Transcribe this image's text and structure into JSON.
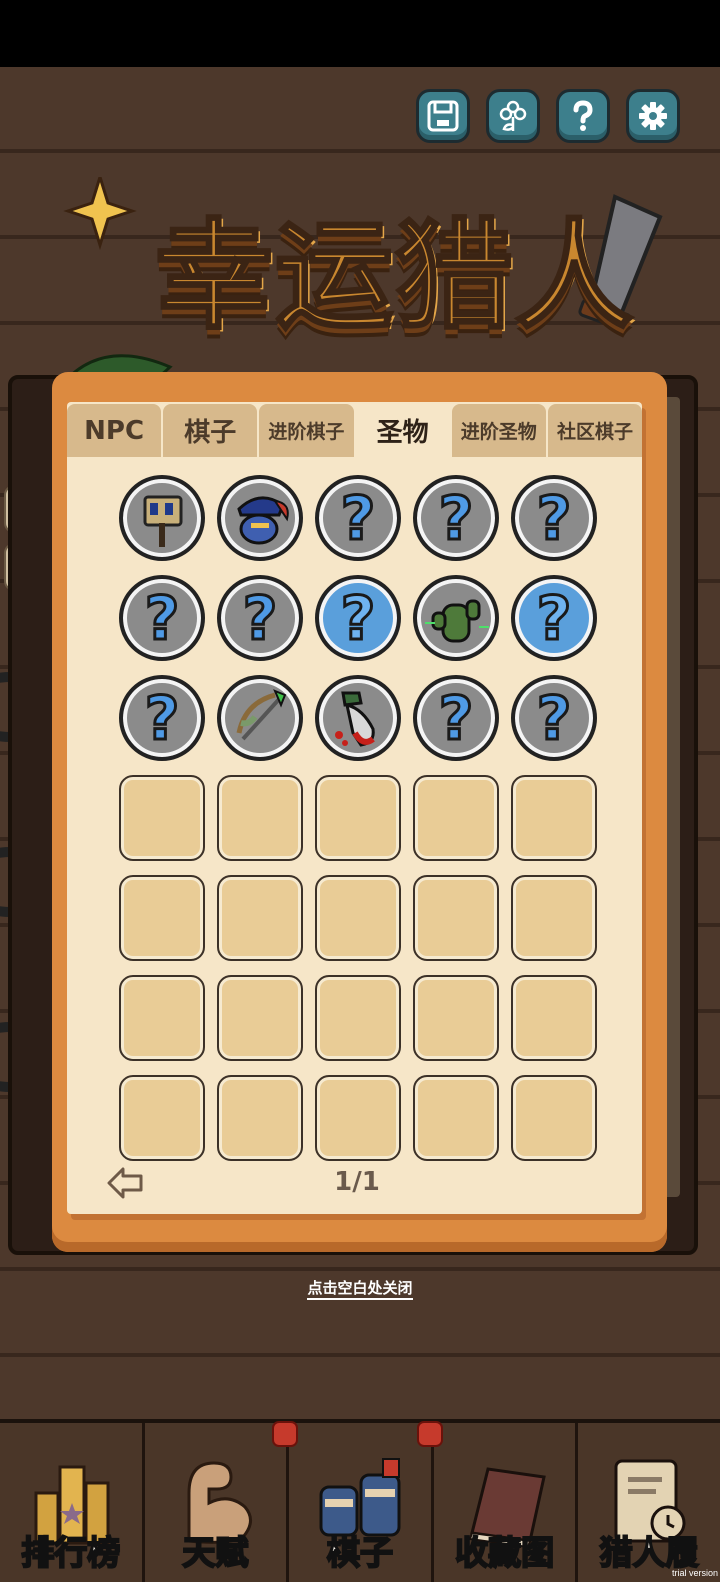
{
  "header": {
    "buttons": [
      {
        "name": "save-button",
        "icon": "save-icon"
      },
      {
        "name": "community-button",
        "icon": "flower-icon"
      },
      {
        "name": "help-button",
        "icon": "question-icon"
      },
      {
        "name": "settings-button",
        "icon": "gear-icon"
      }
    ]
  },
  "title": {
    "text": "幸运猎人"
  },
  "panel": {
    "tabs": [
      {
        "label": "NPC",
        "active": false
      },
      {
        "label": "棋子",
        "active": false
      },
      {
        "label": "进阶棋子",
        "active": false
      },
      {
        "label": "圣物",
        "active": true
      },
      {
        "label": "进阶圣物",
        "active": false
      },
      {
        "label": "社区棋子",
        "active": false
      }
    ],
    "grid_rows": [
      [
        "scroll-relic",
        "captain-relic",
        "unknown",
        "unknown",
        "unknown"
      ],
      [
        "unknown",
        "unknown",
        "unknown-highlight",
        "cactus-relic",
        "unknown-highlight"
      ],
      [
        "unknown",
        "bow-relic",
        "bloody-sack-relic",
        "unknown",
        "unknown"
      ],
      [
        "empty",
        "empty",
        "empty",
        "empty",
        "empty"
      ],
      [
        "empty",
        "empty",
        "empty",
        "empty",
        "empty"
      ],
      [
        "empty",
        "empty",
        "empty",
        "empty",
        "empty"
      ],
      [
        "empty",
        "empty",
        "empty",
        "empty",
        "empty"
      ]
    ],
    "unknown_symbol": "?",
    "page_indicator": "1/1"
  },
  "close_hint": "点击空白处关闭",
  "nav": {
    "items": [
      {
        "label": "排行榜",
        "icon": "trophy-icon",
        "badge": false
      },
      {
        "label": "天赋",
        "icon": "muscle-icon",
        "badge": true
      },
      {
        "label": "棋子",
        "icon": "ninja-icon",
        "badge": true
      },
      {
        "label": "收藏图",
        "icon": "book-icon",
        "badge": false
      },
      {
        "label": "猎人履",
        "icon": "clock-scroll-icon",
        "badge": false
      }
    ]
  },
  "watermark": "trial version",
  "colors": {
    "background": "#4d382b",
    "panel_frame": "#dc8a40",
    "panel_page": "#f6e6c8",
    "tab": "#d7b98c",
    "button": "#3d7f8c",
    "unknown_blue": "#4f9ae5",
    "badge_red": "#c63a2c"
  }
}
